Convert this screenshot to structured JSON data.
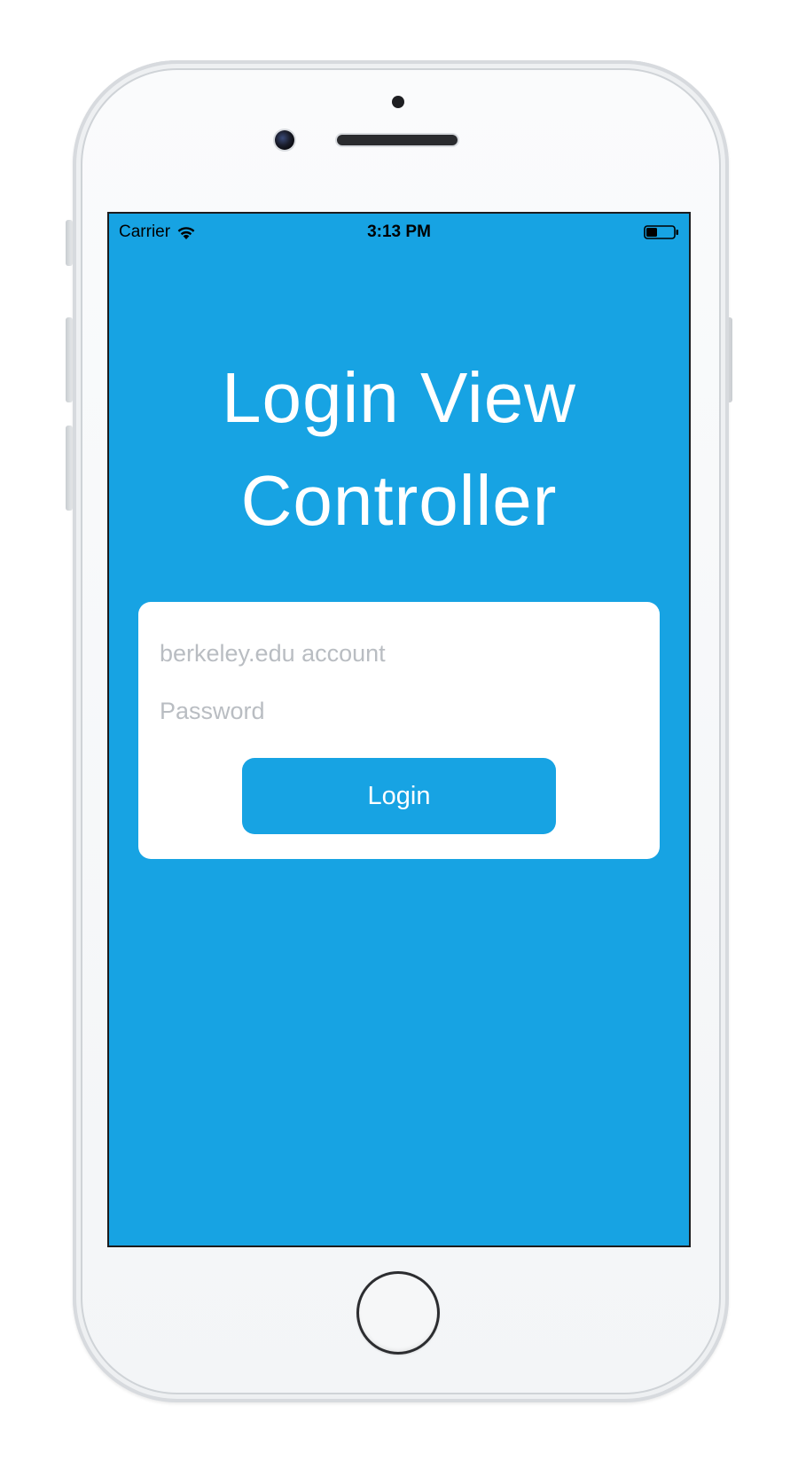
{
  "device": {
    "model": "iPhone",
    "frame_color": "#f5f6f8",
    "screen_color": "#17a3e3"
  },
  "status_bar": {
    "carrier": "Carrier",
    "time": "3:13 PM",
    "wifi_icon": "wifi-icon",
    "battery_icon": "battery-icon",
    "battery_level": 0.4
  },
  "login": {
    "title_line1": "Login View",
    "title_line2": "Controller",
    "account_placeholder": "berkeley.edu account",
    "account_value": "",
    "password_placeholder": "Password",
    "password_value": "",
    "button_label": "Login"
  },
  "colors": {
    "accent": "#17a3e3",
    "card": "#ffffff",
    "placeholder": "#b9bdc2"
  }
}
